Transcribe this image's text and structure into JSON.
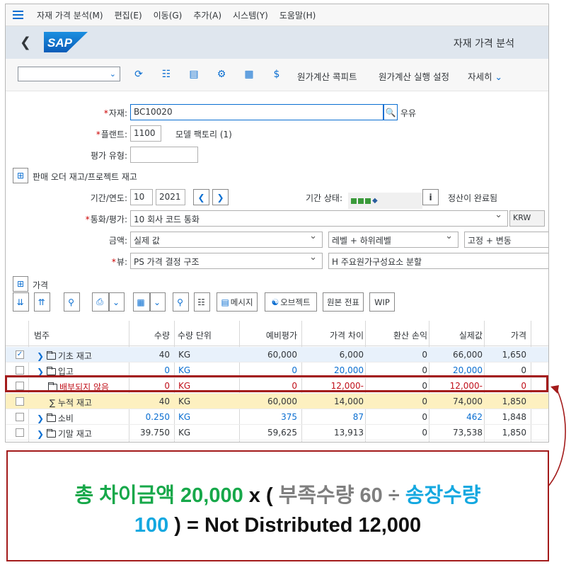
{
  "menu": {
    "items": [
      "자재 가격 분석(M)",
      "편집(E)",
      "이동(G)",
      "추가(A)",
      "시스템(Y)",
      "도움말(H)"
    ]
  },
  "shell": {
    "logo_text": "SAP",
    "title": "자재 가격 분석"
  },
  "toolbar": {
    "dropdown_value": "",
    "cost_cockpit": "원가계산 콕피트",
    "cost_run_settings": "원가계산 실행 설정",
    "more": "자세히"
  },
  "form": {
    "material_label": "자재:",
    "material_value": "BC10020",
    "material_desc": "우유",
    "plant_label": "플랜트:",
    "plant_value": "1100",
    "plant_desc": "모델 팩토리 (1)",
    "valuation_type_label": "평가 유형:",
    "valuation_type_value": "",
    "sales_order_stock": "판매 오더 재고/프로젝트 재고",
    "period_label": "기간/연도:",
    "period_value": "10",
    "year_value": "2021",
    "period_status_label": "기간 상태:",
    "settlement_done": "정산이 완료됨",
    "currency_label": "통화/평가:",
    "currency_value": "10 회사 코드 통화",
    "currency_code": "KRW",
    "amount_label": "금액:",
    "amount_value": "실제 값",
    "level_value": "레벨 + 하위레벨",
    "fixvar_value": "고정 + 변동",
    "view_label": "뷰:",
    "view_value": "PS 가격 결정 구조",
    "view2_value": "H 주요원가구성요소 분할",
    "price_section": "가격"
  },
  "tb2": {
    "message": "메시지",
    "object": "오브젝트",
    "original_doc": "원본 전표",
    "wip": "WIP"
  },
  "table": {
    "headers": [
      "범주",
      "수량",
      "수량 단위",
      "예비평가",
      "가격 차이",
      "환산 손익",
      "실제값",
      "가격"
    ],
    "rows": [
      {
        "category": "기초 재고",
        "qty": "40",
        "unit": "KG",
        "prelim": "60,000",
        "price_diff": "6,000",
        "exch": "0",
        "actual": "66,000",
        "price": "1,650",
        "checked": "✓"
      },
      {
        "category": "입고",
        "qty": "0",
        "unit": "KG",
        "prelim": "0",
        "price_diff": "20,000",
        "exch": "0",
        "actual": "20,000",
        "price": "0",
        "checked": ""
      },
      {
        "category": "배부되지 않음",
        "qty": "0",
        "unit": "KG",
        "prelim": "0",
        "price_diff": "12,000-",
        "exch": "0",
        "actual": "12,000-",
        "price": "0",
        "checked": ""
      },
      {
        "category": "누적 재고",
        "qty": "40",
        "unit": "KG",
        "prelim": "60,000",
        "price_diff": "14,000",
        "exch": "0",
        "actual": "74,000",
        "price": "1,850",
        "checked": ""
      },
      {
        "category": "소비",
        "qty": "0.250",
        "unit": "KG",
        "prelim": "375",
        "price_diff": "87",
        "exch": "0",
        "actual": "462",
        "price": "1,848",
        "checked": ""
      },
      {
        "category": "기말 재고",
        "qty": "39.750",
        "unit": "KG",
        "prelim": "59,625",
        "price_diff": "13,913",
        "exch": "0",
        "actual": "73,538",
        "price": "1,850",
        "checked": ""
      }
    ],
    "sum_symbol": "∑"
  },
  "annotation": {
    "line1_green": "총 차이금액 20,000",
    "line1_x": " x ( ",
    "line1_gray": "부족수량 60 ÷ ",
    "line1_cyan": "송장수량",
    "line2_cyan": "100",
    "line2_black": " ) = Not Distributed 12,000"
  },
  "colors": {
    "sap_blue": "#0a6ed1",
    "highlight_red": "#a31b1b",
    "green": "#17a84a",
    "cyan": "#14a8e0",
    "gray": "#7f7f7f"
  }
}
